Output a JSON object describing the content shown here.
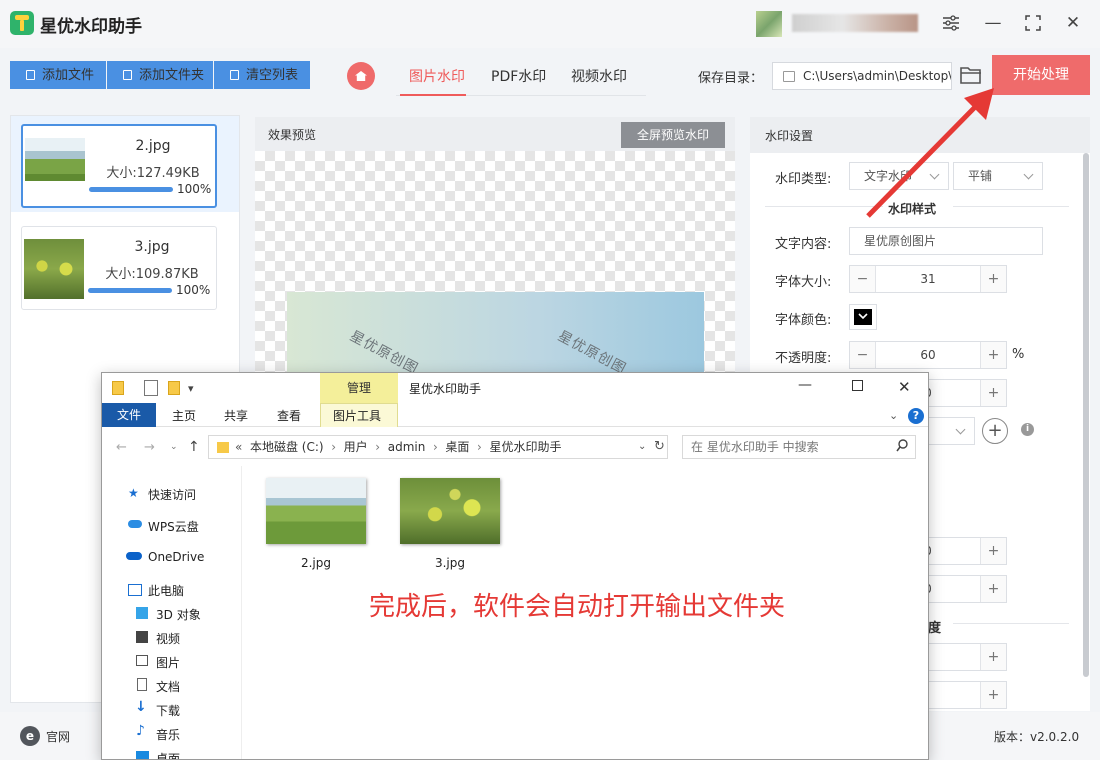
{
  "app": {
    "title": "星优水印助手"
  },
  "toolbar": {
    "add_file": "添加文件",
    "add_folder": "添加文件夹",
    "clear_list": "清空列表"
  },
  "tabs": [
    {
      "label": "图片水印",
      "active": true
    },
    {
      "label": "PDF水印",
      "active": false
    },
    {
      "label": "视频水印",
      "active": false
    }
  ],
  "save": {
    "label": "保存目录：",
    "path": "C:\\Users\\admin\\Desktop\\"
  },
  "start_button": "开始处理",
  "files": [
    {
      "name": "2.jpg",
      "size": "大小:127.49KB",
      "progress": "100%",
      "selected": true
    },
    {
      "name": "3.jpg",
      "size": "大小:109.87KB",
      "progress": "100%",
      "selected": false
    }
  ],
  "preview": {
    "title": "效果预览",
    "fullscreen": "全屏预览水印",
    "watermark_text": "星优原创图"
  },
  "settings": {
    "title": "水印设置",
    "type_label": "水印类型:",
    "type_value": "文字水印",
    "layout_value": "平铺",
    "style_section": "水印样式",
    "text_label": "文字内容:",
    "text_value": "星优原创图片",
    "font_size_label": "字体大小:",
    "font_size_value": "31",
    "font_color_label": "字体颜色:",
    "font_color": "#000000",
    "opacity_label": "不透明度:",
    "opacity_value": "60",
    "opacity_unit": "%",
    "partial_values": [
      "0",
      "0",
      "0"
    ],
    "partial_section": "度"
  },
  "bottom": {
    "website": "官网",
    "version": "版本：v2.0.2.0"
  },
  "explorer": {
    "title": "星优水印助手",
    "manage_tab": "管理",
    "ribbon_tabs": [
      "文件",
      "主页",
      "共享",
      "查看",
      "图片工具"
    ],
    "breadcrumb": [
      "本地磁盘 (C:)",
      "用户",
      "admin",
      "桌面",
      "星优水印助手"
    ],
    "search_placeholder": "在 星优水印助手 中搜索",
    "nav": [
      "快速访问",
      "WPS云盘",
      "OneDrive",
      "此电脑",
      "3D 对象",
      "视频",
      "图片",
      "文档",
      "下载",
      "音乐",
      "桌面"
    ],
    "files": [
      "2.jpg",
      "3.jpg"
    ],
    "annotation": "完成后，软件会自动打开输出文件夹"
  },
  "colors": {
    "accent": "#4a90e2",
    "start": "#ef6b6b",
    "annotation": "#e53935"
  }
}
